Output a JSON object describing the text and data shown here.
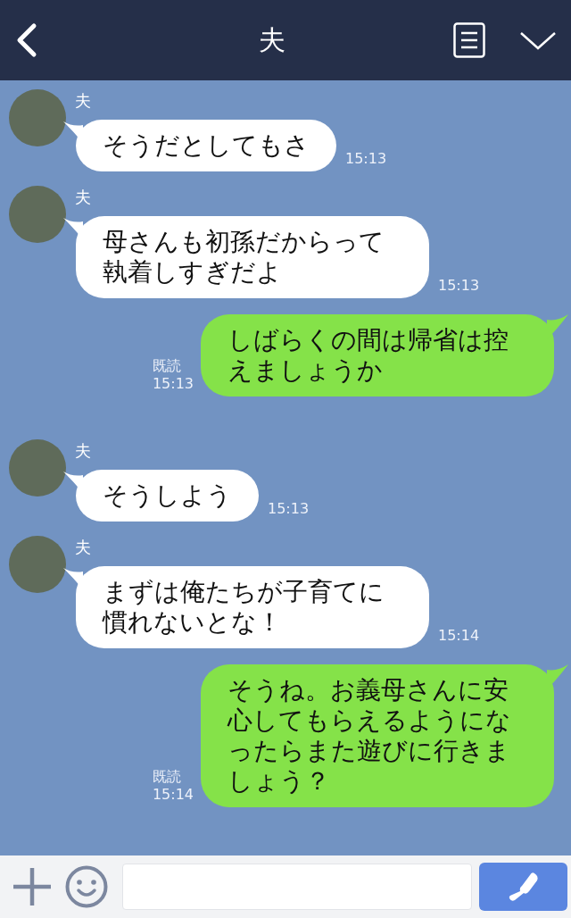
{
  "header": {
    "title": "夫"
  },
  "messages": [
    {
      "kind": "received",
      "sender": "夫",
      "text": "そうだとしてもさ",
      "time": "15:13"
    },
    {
      "kind": "received",
      "sender": "夫",
      "text": "母さんも初孫だからって執着しすぎだよ",
      "time": "15:13"
    },
    {
      "kind": "sent",
      "read": "既読",
      "text": "しばらくの間は帰省は控えましょうか",
      "time": "15:13"
    },
    {
      "kind": "received",
      "sender": "夫",
      "text": "そうしよう",
      "time": "15:13"
    },
    {
      "kind": "received",
      "sender": "夫",
      "text": "まずは俺たちが子育てに慣れないとな！",
      "time": "15:14"
    },
    {
      "kind": "sent",
      "read": "既読",
      "text": "そうね。お義母さんに安心してもらえるようになったらまた遊びに行きましょう？",
      "time": "15:14"
    }
  ]
}
